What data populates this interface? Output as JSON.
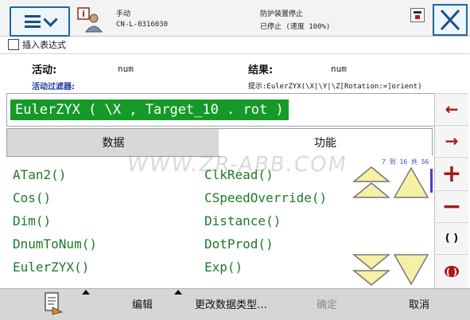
{
  "header": {
    "mode": "手动",
    "controller": "CN-L-0316030",
    "status_line1": "防护装置停止",
    "status_line2": "已停止 (速度 100%)"
  },
  "subtitle": "插入表达式",
  "info": {
    "active_label": "活动:",
    "active_value": "num",
    "result_label": "结果:",
    "result_value": "num",
    "filter_label": "活动过滤器:",
    "hint": "提示:EulerZYX(\\X|\\Y|\\Z[Rotation:=]orient)"
  },
  "expression": "EulerZYX ( \\X , Target_10 . rot )",
  "tabs": {
    "data": "数据",
    "functions": "功能"
  },
  "functions_left": [
    "ATan2()",
    "Cos()",
    "Dim()",
    "DnumToNum()",
    "EulerZYX()"
  ],
  "functions_right": [
    "ClkRead()",
    "CSpeedOverride()",
    "Distance()",
    "DotProd()",
    "Exp()"
  ],
  "page_info": "7 到 16 共 56",
  "watermark": "WWW.ZR-ABB.COM",
  "side_buttons": {
    "left": "←",
    "right": "→",
    "plus": "+",
    "minus": "−",
    "parens": "( )"
  },
  "bottom": {
    "edit": "编辑",
    "change_type": "更改数据类型…",
    "ok": "确定",
    "cancel": "取消"
  },
  "colors": {
    "expression_bg": "#159a28",
    "function_text": "#1d7a27",
    "side_symbols": "#a81818"
  }
}
